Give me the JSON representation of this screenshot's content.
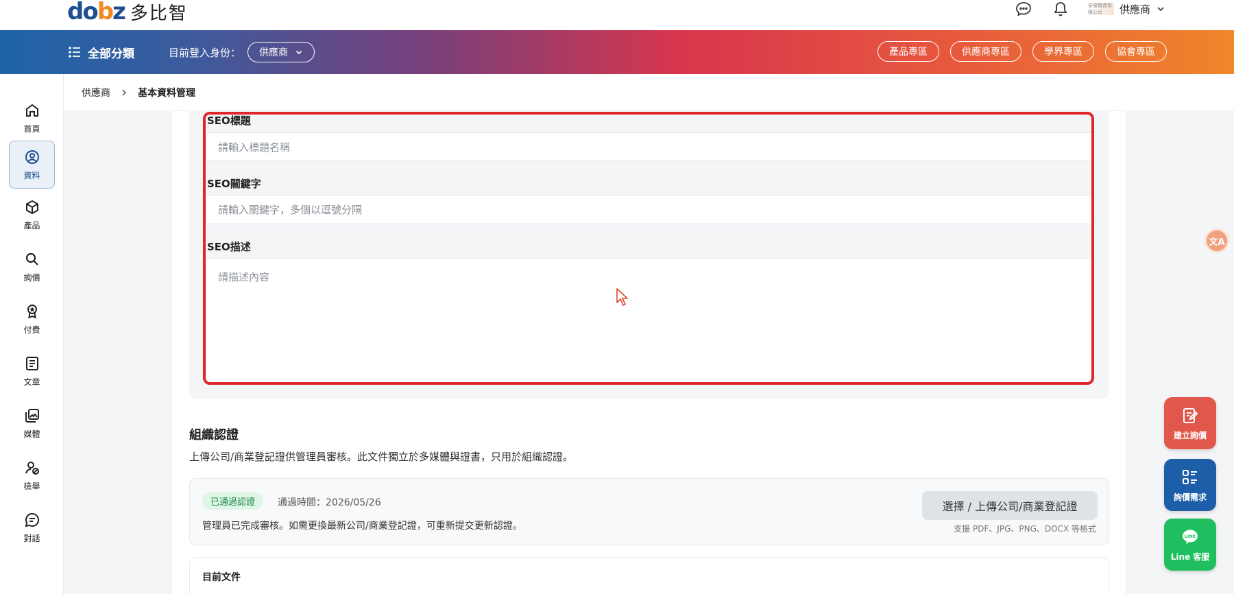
{
  "brand": {
    "logo_mark": "dobz",
    "logo_text": "多比智"
  },
  "header": {
    "user_name": "供應商",
    "user_logo_text": "安億營造有限公司"
  },
  "navbar": {
    "all_categories": "全部分類",
    "identity_label": "目前登入身份：",
    "identity_value": "供應商",
    "links": [
      "產品專區",
      "供應商專區",
      "學界專區",
      "協會專區"
    ]
  },
  "sidebar": {
    "items": [
      {
        "label": "首頁",
        "icon": "home-icon"
      },
      {
        "label": "資料",
        "icon": "user-circle-icon"
      },
      {
        "label": "產品",
        "icon": "box-icon"
      },
      {
        "label": "詢價",
        "icon": "search-icon"
      },
      {
        "label": "付費",
        "icon": "award-icon"
      },
      {
        "label": "文章",
        "icon": "document-icon"
      },
      {
        "label": "媒體",
        "icon": "media-icon"
      },
      {
        "label": "檢舉",
        "icon": "report-icon"
      },
      {
        "label": "對話",
        "icon": "chat-icon"
      }
    ],
    "active": "資料"
  },
  "breadcrumb": {
    "parent": "供應商",
    "current": "基本資料管理"
  },
  "seo": {
    "title_label": "SEO標題",
    "title_placeholder": "請輸入標題名稱",
    "keywords_label": "SEO關鍵字",
    "keywords_placeholder": "請輸入關鍵字，多個以逗號分隔",
    "description_label": "SEO描述",
    "description_placeholder": "請描述內容"
  },
  "org_cert": {
    "title": "組織認證",
    "description": "上傳公司/商業登記證供管理員審核。此文件獨立於多媒體與證書，只用於組織認證。",
    "status_badge": "已通過認證",
    "pass_time": "通過時間：2026/05/26",
    "note": "管理員已完成審核。如需更換最新公司/商業登記證，可重新提交更新認證。",
    "upload_button": "選擇 / 上傳公司/商業登記證",
    "formats": "支援 PDF、JPG、PNG、DOCX 等格式",
    "current_docs_label": "目前文件"
  },
  "floating": {
    "create_inquiry": "建立詢價",
    "inquiry_needs": "詢價需求",
    "line_service": "Line 客服",
    "line_badge": "LINE",
    "translate": "文A"
  },
  "colors": {
    "accent_red": "#e0262d",
    "fab_red": "#e2574c",
    "fab_blue": "#1d5ea8",
    "fab_green": "#1fbf5f",
    "badge_green": "#1c8a47"
  }
}
